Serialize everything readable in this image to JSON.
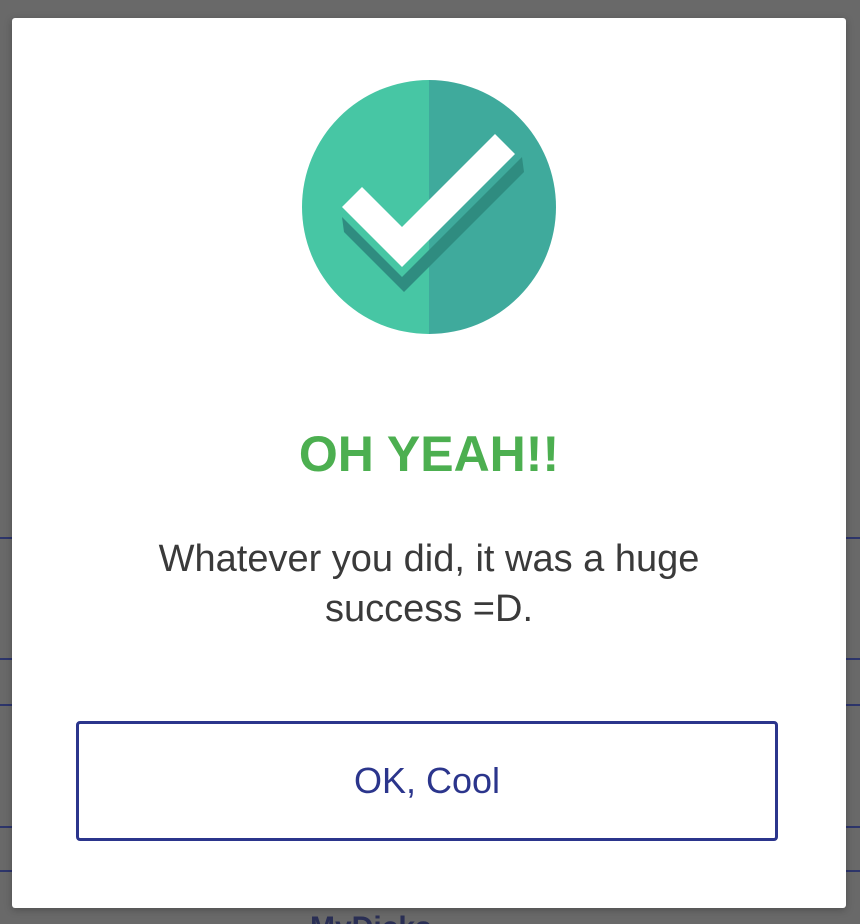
{
  "dialog": {
    "icon": "check-circle-icon",
    "title": "OH YEAH!!",
    "message": "Whatever you did, it was a huge success =D.",
    "button_label": "OK, Cool"
  },
  "background": {
    "partial_text": "MyDicks"
  },
  "colors": {
    "title": "#4caf50",
    "button": "#2b358c",
    "icon_left": "#47c6a4",
    "icon_right": "#3faa9c",
    "message": "#3a3a3a"
  }
}
